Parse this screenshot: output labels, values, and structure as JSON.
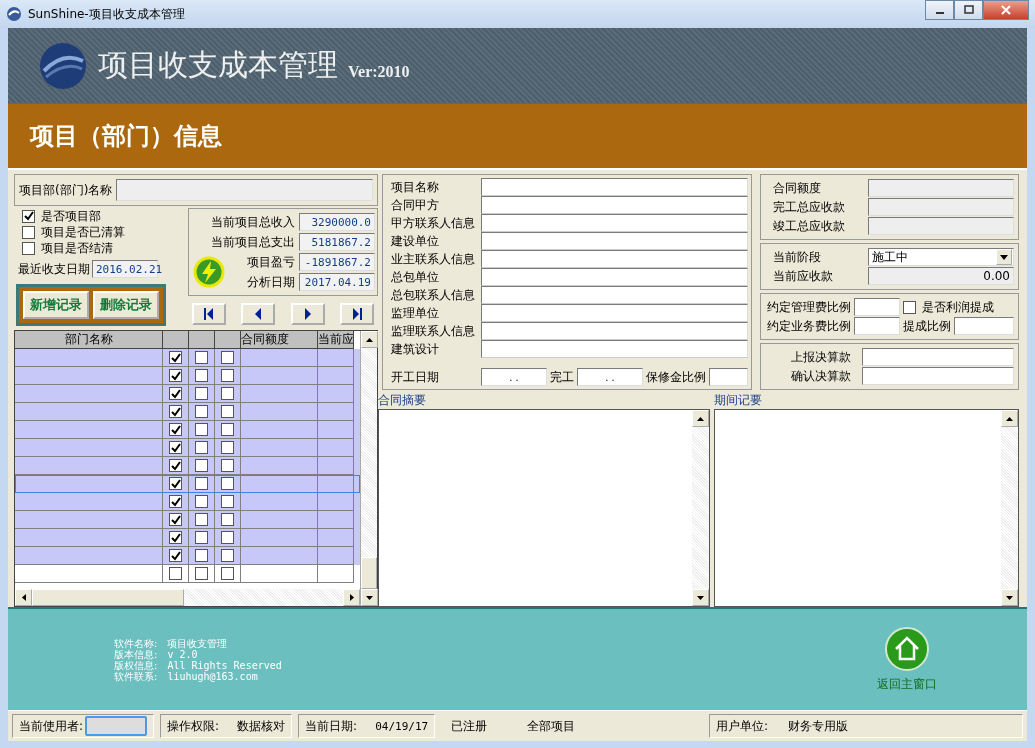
{
  "window": {
    "title": "SunShine-项目收支成本管理"
  },
  "banner": {
    "title": "项目收支成本管理",
    "version": "Ver:2010"
  },
  "section_title": "项目（部门）信息",
  "dept_name": {
    "label": "项目部(部门)名称"
  },
  "flags": [
    {
      "label": "是否项目部",
      "checked": true
    },
    {
      "label": "项目是否已清算",
      "checked": false
    },
    {
      "label": "项目是否结清",
      "checked": false
    }
  ],
  "last_date": {
    "label": "最近收支日期",
    "value": "2016.02.21"
  },
  "summary": [
    {
      "label": "当前项目总收入",
      "value": "3290000.0"
    },
    {
      "label": "当前项目总支出",
      "value": "5181867.2"
    },
    {
      "label": "项目盈亏",
      "value": "-1891867.2"
    },
    {
      "label": "分析日期",
      "value": "2017.04.19"
    }
  ],
  "buttons": [
    "新增记录",
    "删除记录"
  ],
  "table": {
    "columns": [
      "部门名称",
      "合同额度",
      "当前应"
    ],
    "rows": [
      {
        "checks": [
          true,
          false,
          false
        ],
        "highlighted": true,
        "current": false
      },
      {
        "checks": [
          true,
          false,
          false
        ],
        "highlighted": true,
        "current": false
      },
      {
        "checks": [
          true,
          false,
          false
        ],
        "highlighted": true,
        "current": false
      },
      {
        "checks": [
          true,
          false,
          false
        ],
        "highlighted": true,
        "current": false
      },
      {
        "checks": [
          true,
          false,
          false
        ],
        "highlighted": true,
        "current": false
      },
      {
        "checks": [
          true,
          false,
          false
        ],
        "highlighted": true,
        "current": false
      },
      {
        "checks": [
          true,
          false,
          false
        ],
        "highlighted": true,
        "current": false
      },
      {
        "checks": [
          true,
          false,
          false
        ],
        "highlighted": true,
        "current": true
      },
      {
        "checks": [
          true,
          false,
          false
        ],
        "highlighted": true,
        "current": false
      },
      {
        "checks": [
          true,
          false,
          false
        ],
        "highlighted": true,
        "current": false
      },
      {
        "checks": [
          true,
          false,
          false
        ],
        "highlighted": true,
        "current": false
      },
      {
        "checks": [
          true,
          false,
          false
        ],
        "highlighted": true,
        "current": false
      },
      {
        "checks": [
          false,
          false,
          false
        ],
        "highlighted": false,
        "current": false
      }
    ]
  },
  "project_fields": [
    "项目名称",
    "合同甲方",
    "甲方联系人信息",
    "建设单位",
    "业主联系人信息",
    "总包单位",
    "总包联系人信息",
    "监理单位",
    "监理联系人信息",
    "建筑设计"
  ],
  "dates": [
    {
      "label": "开工日期",
      "value": ".  ."
    },
    {
      "label": "完工",
      "value": ".  ."
    },
    {
      "label": "保修金比例"
    }
  ],
  "memos": [
    "合同摘要",
    "期间记要"
  ],
  "amounts": [
    "合同额度",
    "完工总应收款",
    "竣工总应收款"
  ],
  "stage": {
    "label": "当前阶段",
    "value": "施工中"
  },
  "receivable": {
    "label": "当前应收款",
    "value": "0.00"
  },
  "rates": {
    "mgmt_label": "约定管理费比例",
    "profit_share": {
      "label": "是否利润提成",
      "checked": false
    },
    "biz_label": "约定业务费比例",
    "share_label": "提成比例"
  },
  "settlement": [
    "上报决算款",
    "确认决算款"
  ],
  "info": [
    {
      "label": "软件名称:",
      "value": "项目收支管理"
    },
    {
      "label": "版本信息:",
      "value": "v 2.0"
    },
    {
      "label": "版权信息:",
      "value": "All Rights Reserved"
    },
    {
      "label": "软件联系:",
      "value": "liuhugh@163.com"
    }
  ],
  "home_button": "返回主窗口",
  "status_bar": {
    "user_label": "当前使用者:",
    "permission_label": "操作权限:",
    "permission": "数据核对",
    "date_label": "当前日期:",
    "date": "04/19/17",
    "registered": "已注册",
    "scope": "全部项目",
    "unit_label": "用户单位:",
    "unit": "财务专用版"
  }
}
